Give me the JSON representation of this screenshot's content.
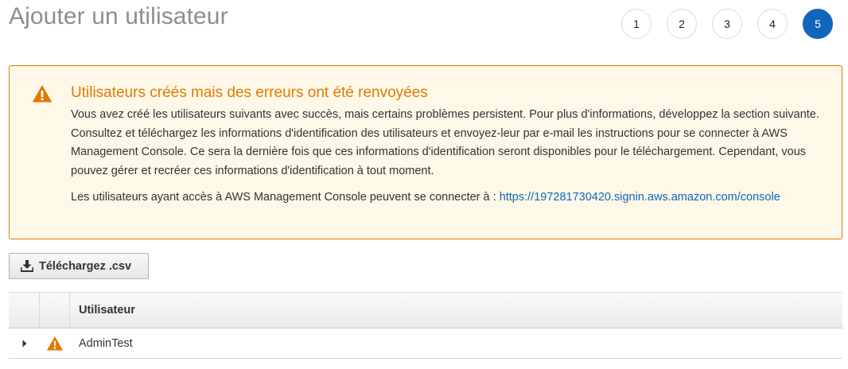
{
  "header": {
    "title": "Ajouter un utilisateur"
  },
  "wizard": {
    "steps": [
      "1",
      "2",
      "3",
      "4",
      "5"
    ],
    "active_step": "5"
  },
  "alert": {
    "icon": "warning-icon",
    "color": "#e07a00",
    "title": "Utilisateurs créés mais des erreurs ont été renvoyées",
    "body": "Vous avez créé les utilisateurs suivants avec succès, mais certains problèmes persistent. Pour plus d'informations, développez la section suivante. Consultez et téléchargez les informations d'identification des utilisateurs et envoyez-leur par e-mail les instructions pour se connecter à AWS Management Console. Ce sera la dernière fois que ces informations d'identification seront disponibles pour le téléchargement. Cependant, vous pouvez gérer et recréer ces informations d'identification à tout moment.",
    "console_text": "Les utilisateurs ayant accès à AWS Management Console peuvent se connecter à :",
    "console_url": "https://197281730420.signin.aws.amazon.com/console"
  },
  "toolbar": {
    "download_label": "Téléchargez .csv",
    "download_icon": "download-icon"
  },
  "table": {
    "columns": [
      "",
      "",
      "Utilisateur"
    ],
    "rows": [
      {
        "user": "AdminTest",
        "status_icon": "warning-icon",
        "expanded": false
      }
    ]
  },
  "colors": {
    "accent": "#1166bb",
    "warning": "#e07a00",
    "alert_background": "#fef8e8"
  }
}
